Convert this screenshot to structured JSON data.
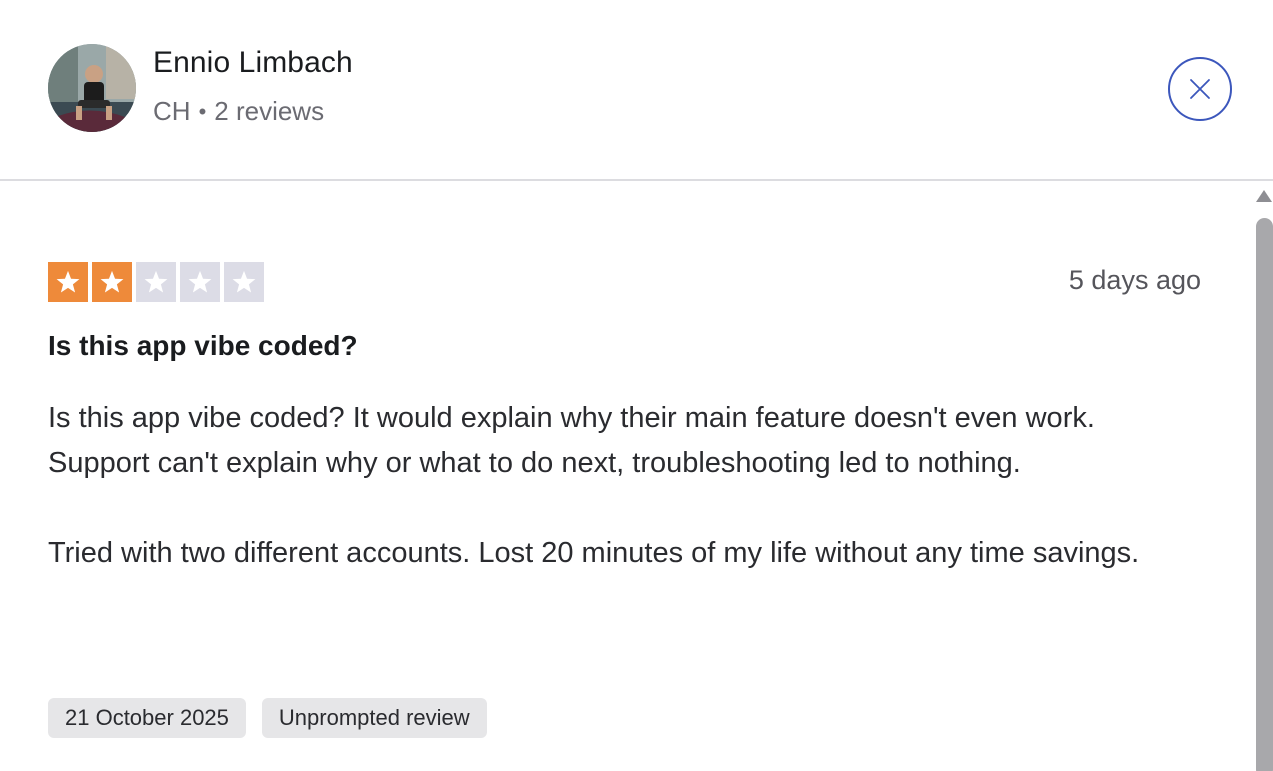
{
  "reviewer": {
    "name": "Ennio Limbach",
    "country": "CH",
    "separator": "•",
    "review_count": "2 reviews"
  },
  "review": {
    "rating": 2,
    "max_rating": 5,
    "relative_date": "5 days ago",
    "title": "Is this app vibe coded?",
    "paragraphs": [
      "Is this app vibe coded? It would explain why their main feature doesn't even work. Support can't explain why or what to do next, troubleshooting led to nothing.",
      "Tried with two different accounts. Lost 20 minutes of my life without any time savings."
    ],
    "tags": [
      "21 October 2025",
      "Unprompted review"
    ]
  },
  "colors": {
    "star_filled": "#ee8a3a",
    "star_empty": "#dcdce6",
    "close_accent": "#3c57bc"
  },
  "icons": {
    "close": "close-icon",
    "star": "star-icon",
    "scroll_up": "scroll-up-arrow-icon"
  }
}
